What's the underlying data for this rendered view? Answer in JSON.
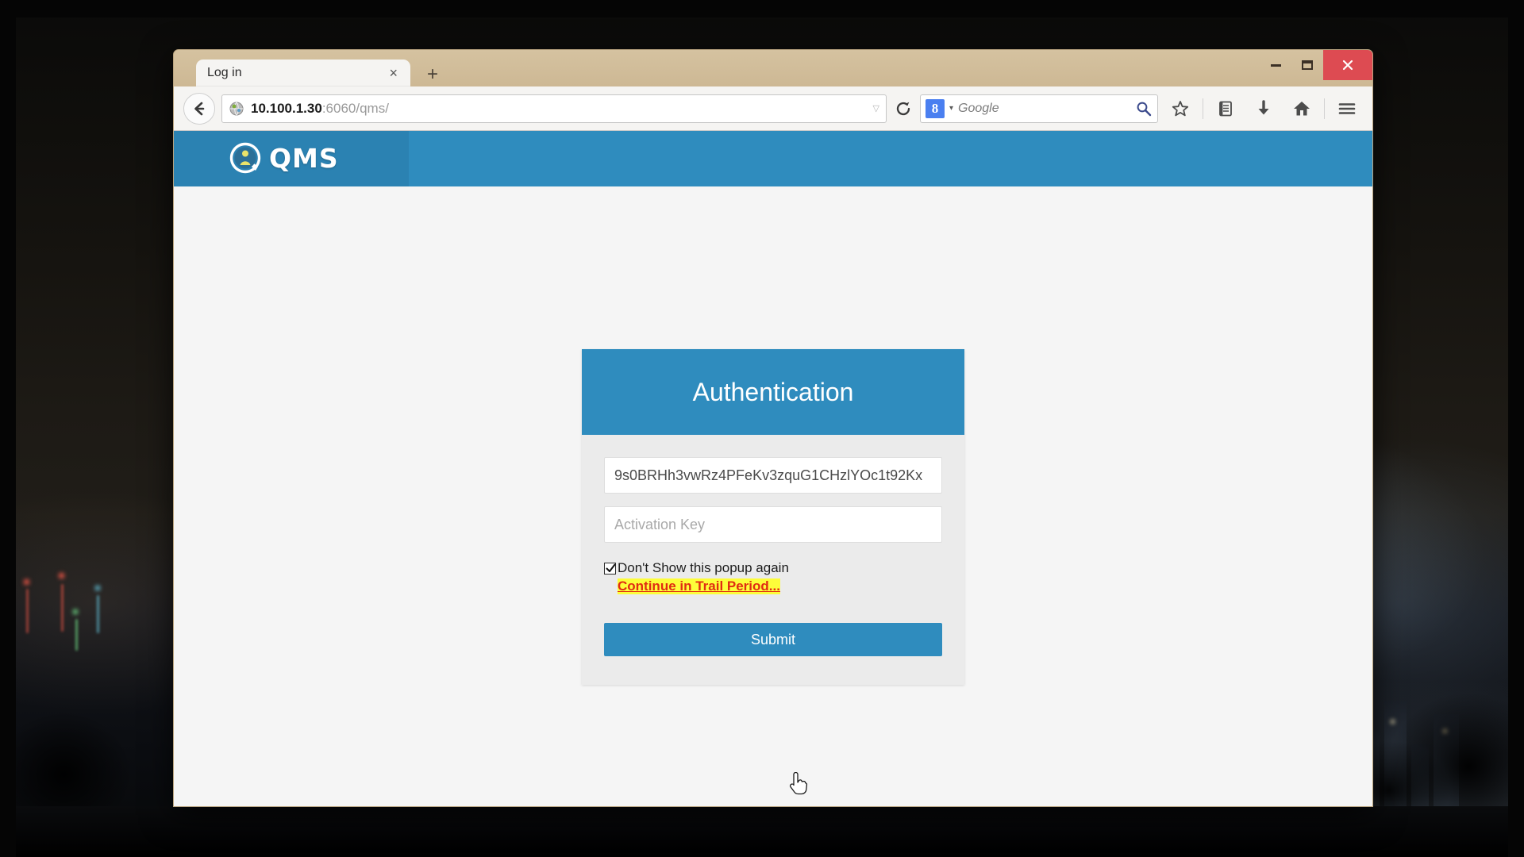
{
  "window": {
    "controls": {
      "minimize": "–",
      "maximize": "□",
      "close": "×"
    }
  },
  "browser": {
    "tab": {
      "title": "Log in",
      "close_label": "×"
    },
    "new_tab_label": "+",
    "toolbar": {
      "back_icon": "back-arrow-icon",
      "url_host": "10.100.1.30",
      "url_rest": ":6060/qms/",
      "url_dropdown": "▽",
      "reload_icon": "reload-icon",
      "search_engine_glyph": "8",
      "search_engine_caret": "▾",
      "search_placeholder": "Google",
      "search_icon": "search-magnifier-icon",
      "bookmark_icon": "star-icon",
      "reader_icon": "reading-list-icon",
      "downloads_icon": "download-arrow-icon",
      "home_icon": "home-icon",
      "menu_icon": "hamburger-menu-icon"
    }
  },
  "site": {
    "brand_text": "QMS",
    "brand_mark": "qms-circle-person-logo",
    "header_color": "#2f8cbe"
  },
  "auth": {
    "title": "Authentication",
    "license_key_value": "9s0BRHh3vwRz4PFeKv3zquG1CHzlYOc1t92Kx",
    "activation_key_placeholder": "Activation Key",
    "dont_show_label": "Don't Show this popup again",
    "dont_show_checked": true,
    "trial_link": "Continue in Trail Period...",
    "trial_link_color": "#e02b12",
    "trial_highlight_color": "#fdfd3a",
    "submit_label": "Submit",
    "accent_color": "#2f8cbe"
  }
}
